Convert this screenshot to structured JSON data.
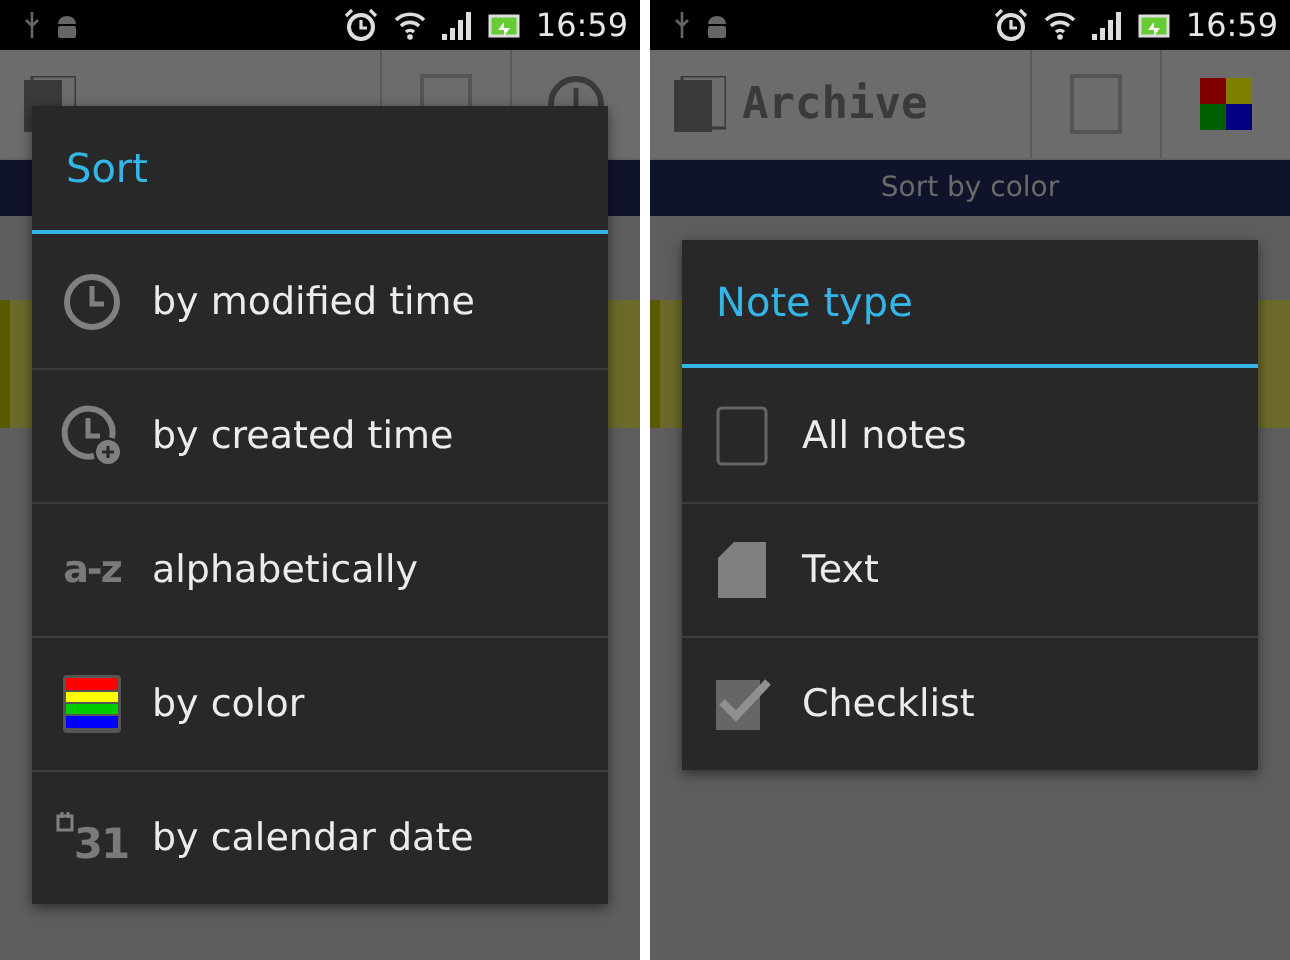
{
  "screens": [
    {
      "status_bar": {
        "time": "16:59"
      },
      "action_bar": {
        "actions": [
          {
            "kind": "filter"
          },
          {
            "kind": "clock"
          }
        ]
      },
      "dialog": {
        "title": "Sort",
        "items": [
          {
            "kind": "clock",
            "label": "by modified time"
          },
          {
            "kind": "clock-plus",
            "label": "by created time"
          },
          {
            "kind": "letters",
            "icon_text": "a-z",
            "label": "alphabetically"
          },
          {
            "kind": "rainbow",
            "label": "by color"
          },
          {
            "kind": "calendar",
            "icon_text": "31",
            "label": "by calendar date"
          }
        ]
      }
    },
    {
      "status_bar": {
        "time": "16:59"
      },
      "action_bar": {
        "title": "Archive",
        "actions": [
          {
            "kind": "filter"
          },
          {
            "kind": "colors"
          }
        ]
      },
      "subtitle": "Sort by color",
      "dialog": {
        "title": "Note type",
        "items": [
          {
            "kind": "square",
            "label": "All notes"
          },
          {
            "kind": "page",
            "label": "Text"
          },
          {
            "kind": "check",
            "label": "Checklist"
          }
        ]
      }
    }
  ]
}
